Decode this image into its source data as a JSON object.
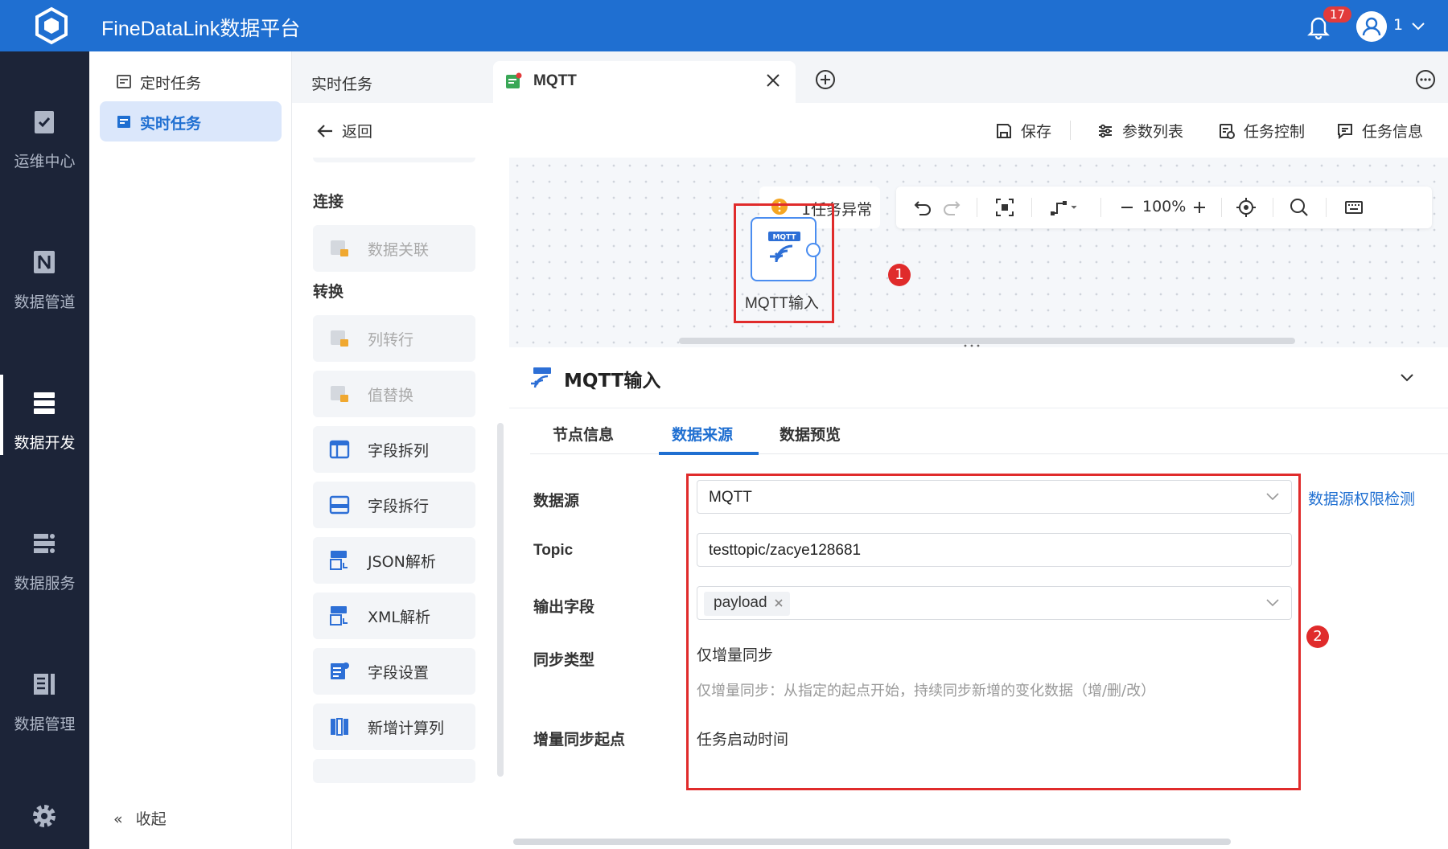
{
  "app": {
    "title": "FineDataLink数据平台",
    "notification_count": "17",
    "user": "1"
  },
  "leftnav": [
    {
      "label": "运维中心",
      "icon": "clipboard-check-icon"
    },
    {
      "label": "数据管道",
      "icon": "pipeline-icon"
    },
    {
      "label": "数据开发",
      "icon": "server-stack-icon",
      "active": true
    },
    {
      "label": "数据服务",
      "icon": "api-service-icon"
    },
    {
      "label": "数据管理",
      "icon": "data-manage-icon"
    }
  ],
  "submenu": {
    "items": [
      "定时任务",
      "实时任务"
    ],
    "active_index": 1,
    "collapse_label": "收起"
  },
  "tabs": {
    "plain": "实时任务",
    "active": "MQTT"
  },
  "toolbar": {
    "back": "返回",
    "save": "保存",
    "params": "参数列表",
    "task_control": "任务控制",
    "task_info": "任务信息"
  },
  "palette": {
    "groups": [
      "连接",
      "转换"
    ],
    "items": [
      "数据关联",
      "列转行",
      "值替换",
      "字段拆列",
      "字段拆行",
      "JSON解析",
      "XML解析",
      "字段设置",
      "新增计算列"
    ]
  },
  "canvas": {
    "warning": "1任务异常",
    "zoom": "100%",
    "node_label": "MQTT输入",
    "node_badge": "MQTT"
  },
  "annotations": [
    "1",
    "2"
  ],
  "props": {
    "title": "MQTT输入",
    "tabs": [
      "节点信息",
      "数据来源",
      "数据预览"
    ],
    "active_tab": 1,
    "fields": {
      "datasource_label": "数据源",
      "datasource_value": "MQTT",
      "perm_link": "数据源权限检测",
      "topic_label": "Topic",
      "topic_value": "testtopic/zacye128681",
      "output_label": "输出字段",
      "output_tag": "payload",
      "sync_type_label": "同步类型",
      "sync_type_value": "仅增量同步",
      "sync_type_hint": "仅增量同步：从指定的起点开始，持续同步新增的变化数据（增/删/改）",
      "sync_start_label": "增量同步起点",
      "sync_start_value": "任务启动时间"
    }
  },
  "colors": {
    "brand": "#1f6fd1",
    "nav_bg": "#1c2438",
    "highlight": "#e02b2b"
  }
}
